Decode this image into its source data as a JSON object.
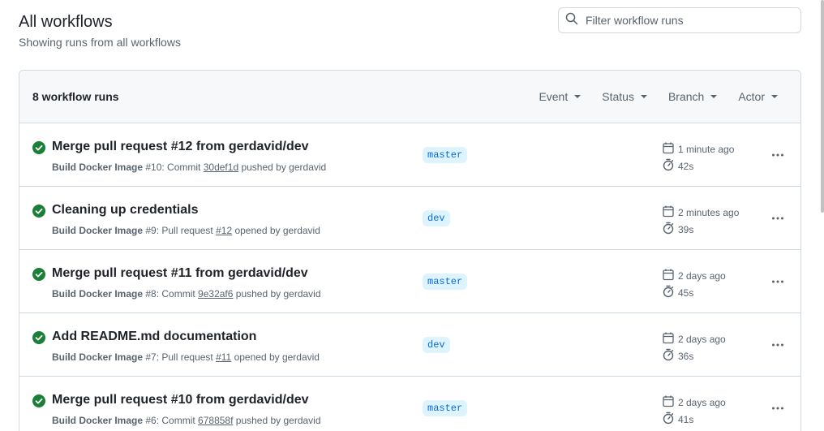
{
  "header": {
    "title": "All workflows",
    "subtitle": "Showing runs from all workflows"
  },
  "filter": {
    "placeholder": "Filter workflow runs"
  },
  "runs_header": {
    "count_label": "8 workflow runs",
    "filters": [
      "Event",
      "Status",
      "Branch",
      "Actor"
    ]
  },
  "colors": {
    "success": "#1a7f37",
    "branch_bg": "#ddf4ff",
    "branch_fg": "#0969da"
  },
  "runs": [
    {
      "title": "Merge pull request #12 from gerdavid/dev",
      "workflow": "Build Docker Image",
      "run_number": " #10: Commit ",
      "ref": "30def1d",
      "suffix": " pushed by gerdavid",
      "branch": "master",
      "ago": "1 minute ago",
      "duration": "42s",
      "status": "success"
    },
    {
      "title": "Cleaning up credentials",
      "workflow": "Build Docker Image",
      "run_number": " #9: Pull request ",
      "ref": "#12",
      "suffix": " opened by gerdavid",
      "branch": "dev",
      "ago": "2 minutes ago",
      "duration": "39s",
      "status": "success"
    },
    {
      "title": "Merge pull request #11 from gerdavid/dev",
      "workflow": "Build Docker Image",
      "run_number": " #8: Commit ",
      "ref": "9e32af6",
      "suffix": " pushed by gerdavid",
      "branch": "master",
      "ago": "2 days ago",
      "duration": "45s",
      "status": "success"
    },
    {
      "title": "Add README.md documentation",
      "workflow": "Build Docker Image",
      "run_number": " #7: Pull request ",
      "ref": "#11",
      "suffix": " opened by gerdavid",
      "branch": "dev",
      "ago": "2 days ago",
      "duration": "36s",
      "status": "success"
    },
    {
      "title": "Merge pull request #10 from gerdavid/dev",
      "workflow": "Build Docker Image",
      "run_number": " #6: Commit ",
      "ref": "678858f",
      "suffix": " pushed by gerdavid",
      "branch": "master",
      "ago": "2 days ago",
      "duration": "41s",
      "status": "success"
    }
  ]
}
